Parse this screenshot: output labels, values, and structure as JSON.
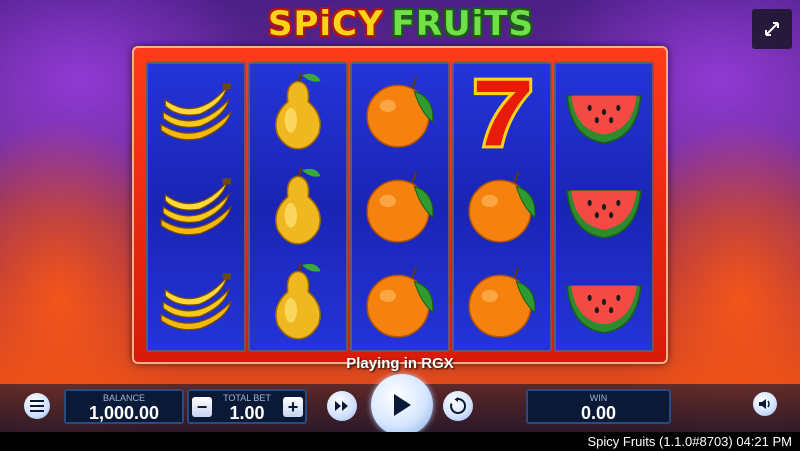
{
  "game": {
    "logo_word1": "SPiCY",
    "logo_word2": "FRUiTS",
    "info_text": "Playing in RGX"
  },
  "reels": [
    [
      "banana",
      "banana",
      "banana"
    ],
    [
      "pear",
      "pear",
      "pear"
    ],
    [
      "orange",
      "orange",
      "orange"
    ],
    [
      "seven",
      "orange",
      "orange"
    ],
    [
      "watermelon",
      "watermelon",
      "watermelon"
    ]
  ],
  "controls": {
    "balance_label": "BALANCE",
    "balance_value": "1,000.00",
    "totalbet_label": "TOTAL BET",
    "totalbet_value": "1.00",
    "minus": "−",
    "plus": "+",
    "win_label": "WIN",
    "win_value": "0.00"
  },
  "status_bar": {
    "text": "Spicy Fruits (1.1.0#8703) 04:21 PM"
  },
  "icons": [
    "fullscreen-icon",
    "menu-icon",
    "turbo-icon",
    "play-icon",
    "autoplay-icon",
    "sound-icon"
  ],
  "colors": {
    "frame": "#e8260f",
    "reel_bg": "#1f2cc8",
    "logo_yellow": "#ffd21a",
    "logo_green": "#6fe04a"
  }
}
